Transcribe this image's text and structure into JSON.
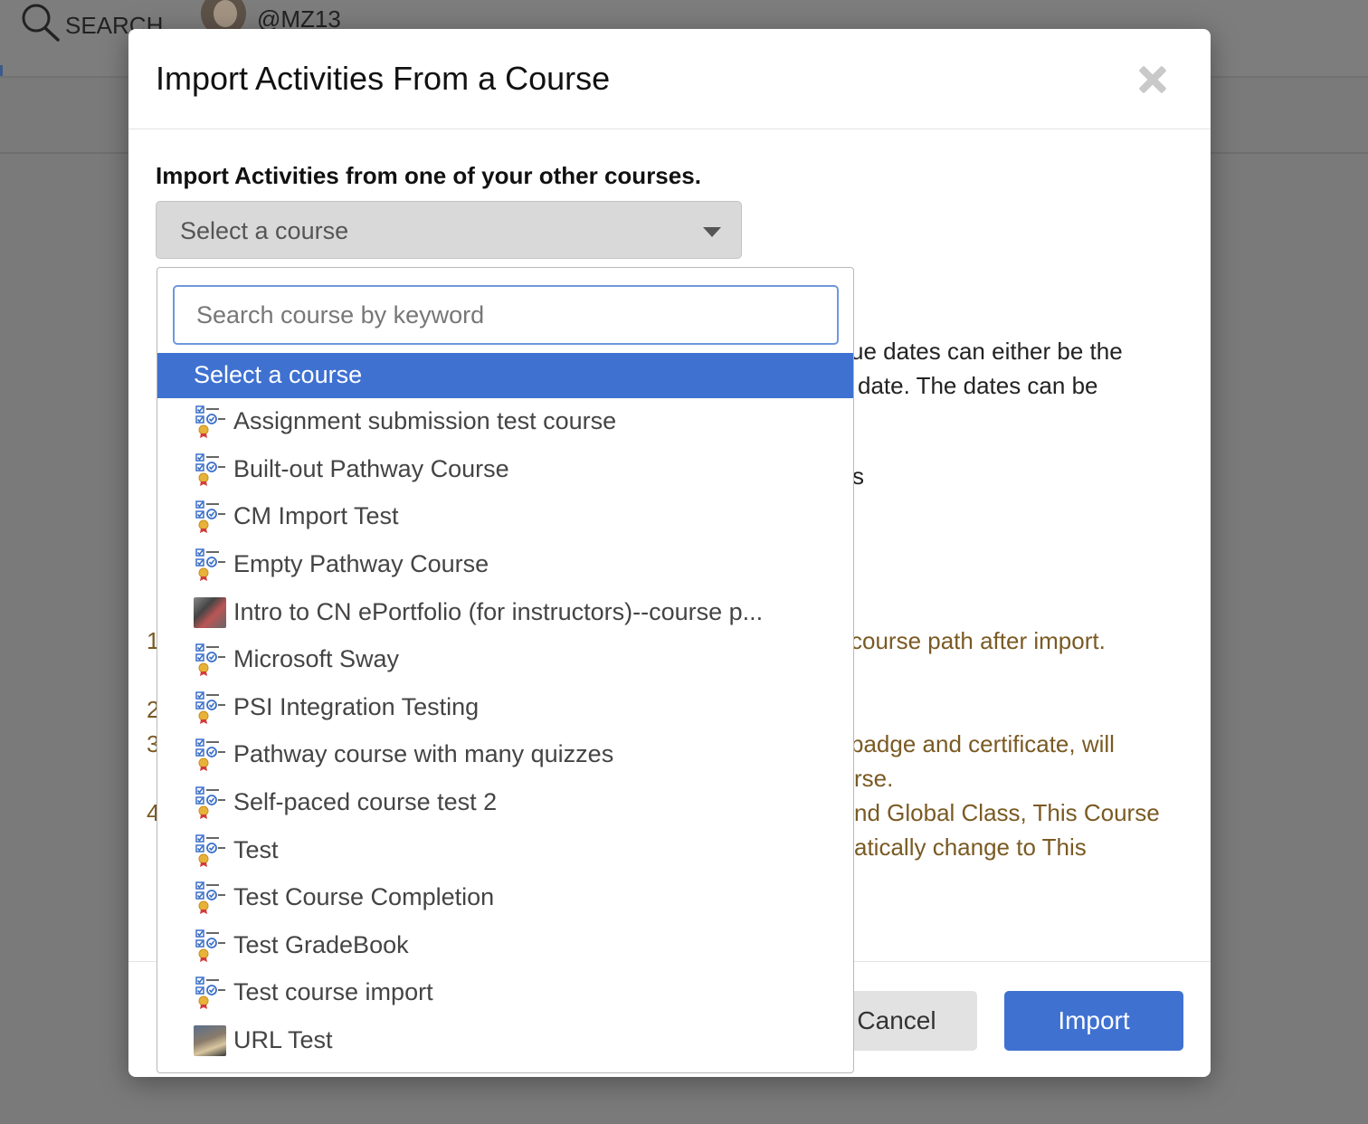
{
  "background": {
    "search_label": "SEARCH",
    "username": "@MZ13"
  },
  "modal": {
    "title": "Import Activities From a Course",
    "intro": "Import Activities from one of your other courses.",
    "select_value": "Select a course",
    "notes_visible": [
      "ue dates can either be the",
      "date. The dates can be",
      "s",
      "course path after import.",
      "badge and certificate, will",
      "rse.",
      "nd Global Class, This Course",
      "atically change to This"
    ],
    "list_numbers": [
      "1",
      "2",
      "3",
      "4"
    ],
    "cancel_label": "Cancel",
    "import_label": "Import"
  },
  "dropdown": {
    "search_placeholder": "Search course by keyword",
    "selected_label": "Select a course",
    "options": [
      {
        "label": "Assignment submission test course",
        "icon": "pathway-icon"
      },
      {
        "label": "Built-out Pathway Course",
        "icon": "pathway-icon"
      },
      {
        "label": "CM Import Test",
        "icon": "pathway-icon"
      },
      {
        "label": "Empty Pathway Course",
        "icon": "pathway-icon"
      },
      {
        "label": "Intro to CN ePortfolio (for instructors)--course p...",
        "icon": "course-thumbnail"
      },
      {
        "label": "Microsoft Sway",
        "icon": "pathway-icon"
      },
      {
        "label": "PSI Integration Testing",
        "icon": "pathway-icon"
      },
      {
        "label": "Pathway course with many quizzes",
        "icon": "pathway-icon"
      },
      {
        "label": "Self-paced course test 2",
        "icon": "pathway-icon"
      },
      {
        "label": "Test",
        "icon": "pathway-icon"
      },
      {
        "label": "Test Course Completion",
        "icon": "pathway-icon"
      },
      {
        "label": "Test GradeBook",
        "icon": "pathway-icon"
      },
      {
        "label": "Test course import",
        "icon": "pathway-icon"
      },
      {
        "label": "URL Test",
        "icon": "course-thumbnail"
      }
    ]
  },
  "colors": {
    "accent": "#3f71d1",
    "note_text": "#7a5a23",
    "overlay": "#7a7a7a"
  }
}
